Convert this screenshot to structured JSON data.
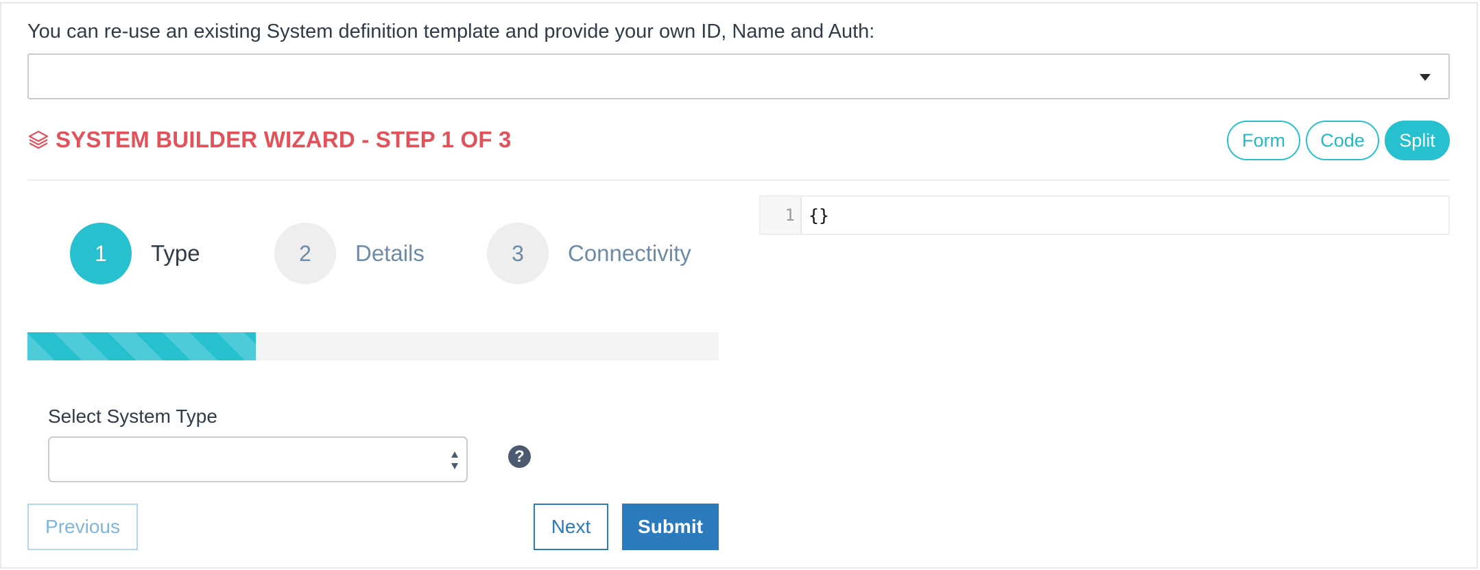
{
  "template": {
    "label": "You can re-use an existing System definition template and provide your own ID, Name and Auth:",
    "selected": ""
  },
  "wizard": {
    "title": "SYSTEM BUILDER WIZARD - STEP 1 OF 3",
    "title_color": "#e2525a",
    "icon": "layers-icon",
    "view_modes": [
      {
        "label": "Form",
        "active": false
      },
      {
        "label": "Code",
        "active": false
      },
      {
        "label": "Split",
        "active": true
      }
    ],
    "steps": [
      {
        "number": "1",
        "label": "Type",
        "active": true
      },
      {
        "number": "2",
        "label": "Details",
        "active": false
      },
      {
        "number": "3",
        "label": "Connectivity",
        "active": false
      }
    ],
    "progress_fraction": 0.33,
    "accent_color": "#26c0cf"
  },
  "form": {
    "system_type_label": "Select System Type",
    "system_type_value": "",
    "help_icon": "question-circle-icon"
  },
  "buttons": {
    "previous": "Previous",
    "next": "Next",
    "submit": "Submit",
    "primary_color": "#2b7bbc"
  },
  "editor": {
    "line_number": "1",
    "content": "{}"
  }
}
